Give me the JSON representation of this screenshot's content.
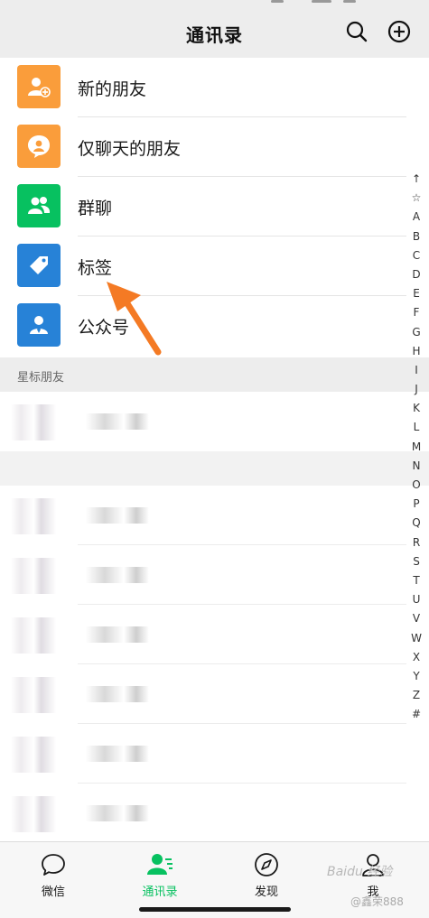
{
  "header": {
    "title": "通讯录"
  },
  "entries": [
    {
      "label": "新的朋友",
      "icon": "add-friend-icon",
      "color": "#fa9d3b"
    },
    {
      "label": "仅聊天的朋友",
      "icon": "chat-only-friend-icon",
      "color": "#fa9d3b"
    },
    {
      "label": "群聊",
      "icon": "group-chat-icon",
      "color": "#07c160"
    },
    {
      "label": "标签",
      "icon": "tag-icon",
      "color": "#2782d7"
    },
    {
      "label": "公众号",
      "icon": "official-account-icon",
      "color": "#2782d7"
    }
  ],
  "section": {
    "title": "星标朋友"
  },
  "index": [
    "↑",
    "☆",
    "A",
    "B",
    "C",
    "D",
    "E",
    "F",
    "G",
    "H",
    "I",
    "J",
    "K",
    "L",
    "M",
    "N",
    "O",
    "P",
    "Q",
    "R",
    "S",
    "T",
    "U",
    "V",
    "W",
    "X",
    "Y",
    "Z",
    "#"
  ],
  "tabs": [
    {
      "label": "微信",
      "icon": "chat-bubble-icon",
      "active": false
    },
    {
      "label": "通讯录",
      "icon": "contacts-icon",
      "active": true
    },
    {
      "label": "发现",
      "icon": "compass-icon",
      "active": false
    },
    {
      "label": "我",
      "icon": "profile-icon",
      "active": false
    }
  ],
  "watermark": {
    "text": "Baidu 经验",
    "author": "@鑫荣888"
  },
  "colors": {
    "accent": "#07c160",
    "arrow": "#f47a24"
  }
}
